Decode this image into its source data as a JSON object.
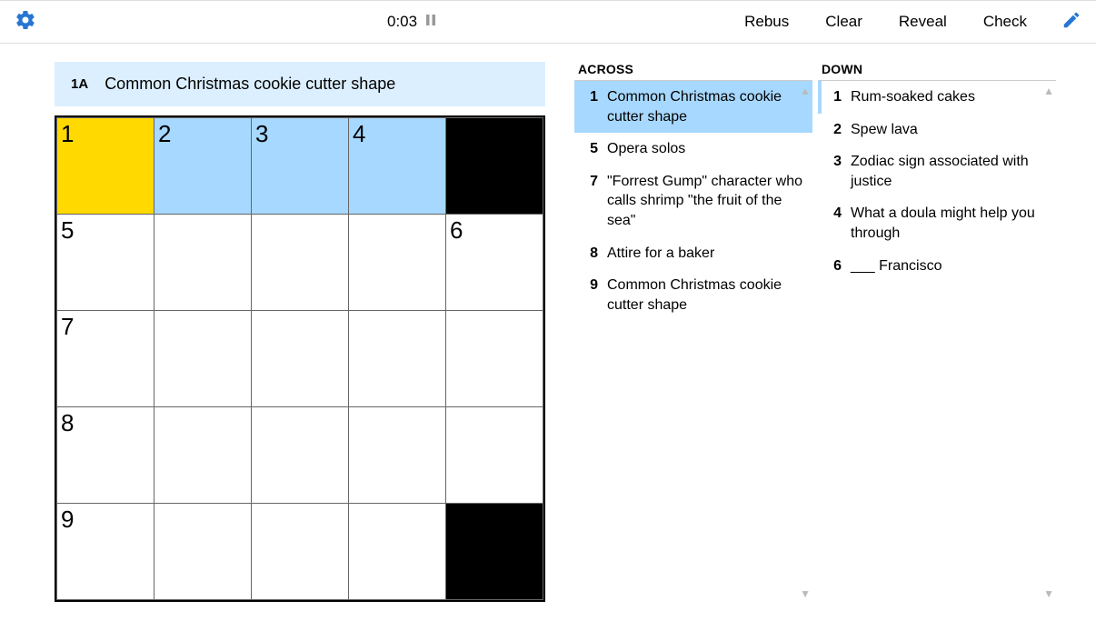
{
  "toolbar": {
    "timer": "0:03",
    "rebus": "Rebus",
    "clear": "Clear",
    "reveal": "Reveal",
    "check": "Check"
  },
  "current_clue": {
    "label": "1A",
    "text": "Common Christmas cookie cutter shape"
  },
  "grid": {
    "rows": 5,
    "cols": 5,
    "cells": [
      [
        {
          "num": "1",
          "state": "yellow"
        },
        {
          "num": "2",
          "state": "blue"
        },
        {
          "num": "3",
          "state": "blue"
        },
        {
          "num": "4",
          "state": "blue"
        },
        {
          "state": "black"
        }
      ],
      [
        {
          "num": "5"
        },
        {},
        {},
        {},
        {
          "num": "6"
        }
      ],
      [
        {
          "num": "7"
        },
        {},
        {},
        {},
        {}
      ],
      [
        {
          "num": "8"
        },
        {},
        {},
        {},
        {}
      ],
      [
        {
          "num": "9"
        },
        {},
        {},
        {},
        {
          "state": "black"
        }
      ]
    ]
  },
  "across": {
    "heading": "ACROSS",
    "clues": [
      {
        "n": "1",
        "t": "Common Christmas cookie cutter shape",
        "active": true
      },
      {
        "n": "5",
        "t": "Opera solos"
      },
      {
        "n": "7",
        "t": "\"Forrest Gump\" character who calls shrimp \"the fruit of the sea\""
      },
      {
        "n": "8",
        "t": "Attire for a baker"
      },
      {
        "n": "9",
        "t": "Common Christmas cookie cutter shape"
      }
    ]
  },
  "down": {
    "heading": "DOWN",
    "clues": [
      {
        "n": "1",
        "t": "Rum-soaked cakes",
        "related": true
      },
      {
        "n": "2",
        "t": "Spew lava"
      },
      {
        "n": "3",
        "t": "Zodiac sign associated with justice"
      },
      {
        "n": "4",
        "t": "What a doula might help you through"
      },
      {
        "n": "6",
        "t": "___ Francisco"
      }
    ]
  }
}
